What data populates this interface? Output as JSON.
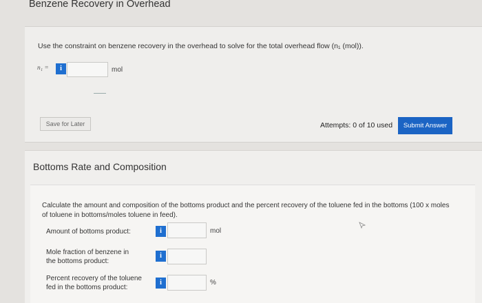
{
  "header": {
    "title": "Benzene Recovery in Overhead"
  },
  "part1": {
    "question": "Use the constraint on benzene recovery in the overhead to solve for the total overhead flow (n₁ (mol)).",
    "variable_label": "n₁ =",
    "info_glyph": "i",
    "input_value": "",
    "unit": "mol",
    "save_label": "Save for Later",
    "attempts_text": "Attempts: 0 of 10 used",
    "submit_label": "Submit Answer"
  },
  "part2": {
    "section_title": "Bottoms Rate and Composition",
    "question": "Calculate the amount and composition of the bottoms product and the percent recovery of the toluene fed in the bottoms (100 x moles of toluene in bottoms/moles toluene in feed).",
    "rows": [
      {
        "label": "Amount of bottoms product:",
        "value": "",
        "unit": "mol"
      },
      {
        "label": "Mole fraction of benzene in the bottoms product:",
        "value": "",
        "unit": ""
      },
      {
        "label": "Percent recovery of the toluene fed in the bottoms product:",
        "value": "",
        "unit": "%"
      }
    ],
    "info_glyph": "i"
  },
  "colors": {
    "accent": "#1b64c4",
    "info_icon": "#1f6fd0"
  }
}
